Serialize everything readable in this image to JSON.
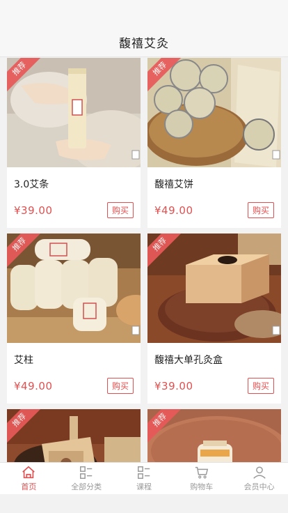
{
  "header": {
    "title": "馥禧艾灸"
  },
  "ribbon_label": "推荐",
  "products": [
    {
      "name": "3.0艾条",
      "price": "¥39.00",
      "buy_label": "购买"
    },
    {
      "name": "馥禧艾饼",
      "price": "¥49.00",
      "buy_label": "购买"
    },
    {
      "name": "艾柱",
      "price": "¥49.00",
      "buy_label": "购买"
    },
    {
      "name": "馥禧大单孔灸盒",
      "price": "¥39.00",
      "buy_label": "购买"
    },
    {
      "name": "",
      "price": "",
      "buy_label": ""
    },
    {
      "name": "",
      "price": "",
      "buy_label": ""
    }
  ],
  "tabbar": {
    "items": [
      {
        "label": "首页",
        "icon": "home-icon",
        "active": true
      },
      {
        "label": "全部分类",
        "icon": "category-icon",
        "active": false
      },
      {
        "label": "课程",
        "icon": "course-icon",
        "active": false
      },
      {
        "label": "购物车",
        "icon": "cart-icon",
        "active": false
      },
      {
        "label": "会员中心",
        "icon": "user-icon",
        "active": false
      }
    ]
  },
  "colors": {
    "accent": "#e05050",
    "ribbon": "#e85a5a"
  }
}
